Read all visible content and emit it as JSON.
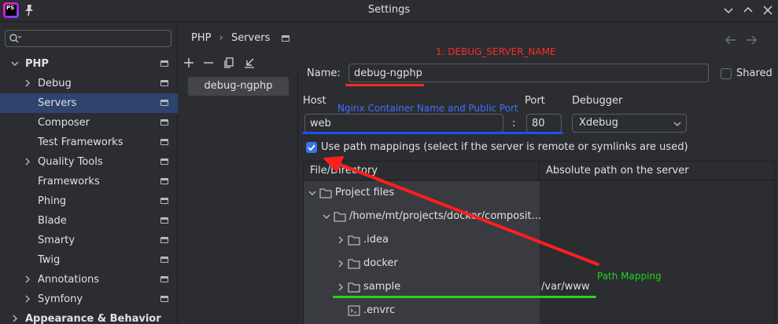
{
  "window": {
    "title": "Settings",
    "app_logo_text": "PS"
  },
  "sidebar": {
    "search_placeholder": "",
    "items": [
      {
        "label": "PHP",
        "level": 0,
        "expanded": true
      },
      {
        "label": "Debug",
        "level": 1,
        "expandable": true
      },
      {
        "label": "Servers",
        "level": 1,
        "selected": true
      },
      {
        "label": "Composer",
        "level": 1
      },
      {
        "label": "Test Frameworks",
        "level": 1
      },
      {
        "label": "Quality Tools",
        "level": 1,
        "expandable": true
      },
      {
        "label": "Frameworks",
        "level": 1
      },
      {
        "label": "Phing",
        "level": 1
      },
      {
        "label": "Blade",
        "level": 1
      },
      {
        "label": "Smarty",
        "level": 1
      },
      {
        "label": "Twig",
        "level": 1
      },
      {
        "label": "Annotations",
        "level": 1,
        "expandable": true
      },
      {
        "label": "Symfony",
        "level": 1,
        "expandable": true
      },
      {
        "label": "Appearance & Behavior",
        "level": 0,
        "expandable": true
      }
    ]
  },
  "breadcrumb": {
    "parent": "PHP",
    "separator": "›",
    "current": "Servers"
  },
  "servers": {
    "items": [
      "debug-ngphp"
    ]
  },
  "form": {
    "name_label": "Name:",
    "name_value": "debug-ngphp",
    "shared_label": "Shared",
    "shared_checked": false,
    "host_label": "Host",
    "host_value": "web",
    "colon": ":",
    "port_label": "Port",
    "port_value": "80",
    "debugger_label": "Debugger",
    "debugger_value": "Xdebug",
    "path_mapping_label": "Use path mappings (select if the server is remote or symlinks are used)",
    "path_mapping_checked": true
  },
  "mapping_table": {
    "headers": [
      "File/Directory",
      "Absolute path on the server"
    ],
    "rows": [
      {
        "name": "Project files",
        "indent": 0,
        "expanded": true,
        "type": "folder",
        "server_path": ""
      },
      {
        "name": "/home/mt/projects/docker/composit...",
        "indent": 1,
        "expanded": true,
        "type": "folder",
        "server_path": ""
      },
      {
        "name": ".idea",
        "indent": 2,
        "expanded": false,
        "type": "folder",
        "server_path": ""
      },
      {
        "name": "docker",
        "indent": 2,
        "expanded": false,
        "type": "folder",
        "server_path": ""
      },
      {
        "name": "sample",
        "indent": 2,
        "expanded": false,
        "type": "folder",
        "server_path": "/var/www"
      },
      {
        "name": ".envrc",
        "indent": 2,
        "expanded": null,
        "type": "file",
        "server_path": ""
      }
    ]
  },
  "annotations": {
    "debug_server_name": "1.  DEBUG_SERVER_NAME",
    "nginx_container": "Nginx Container Name and Public Port",
    "path_mapping": "Path Mapping"
  },
  "colors": {
    "background": "#2b2d30",
    "selection": "#2e436e",
    "accent": "#3574f0",
    "annotation_red": "#ff2a2a",
    "annotation_blue": "#3f6fff",
    "annotation_green": "#22d422"
  }
}
